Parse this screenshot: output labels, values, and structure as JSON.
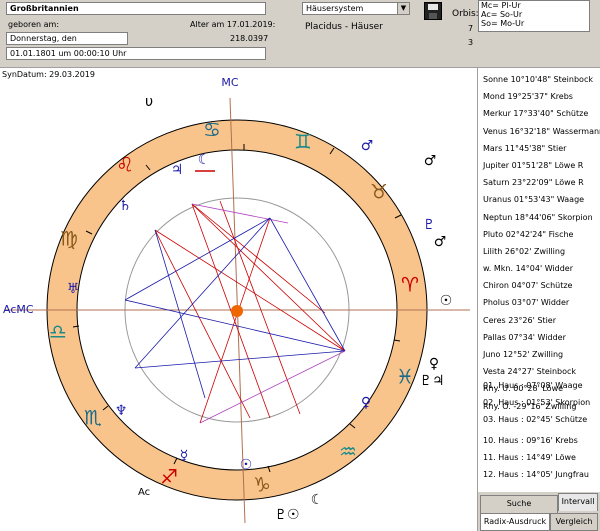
{
  "header": {
    "location": "Großbritannien",
    "born_label": "geboren am:",
    "age_label": "Alter am 17.01.2019:",
    "age_value": "218.0397",
    "weekday": "Donnerstag, den",
    "datetime": "01.01.1801  um  00:00:10 Uhr",
    "house_system_select": "Häusersystem",
    "orbis_label": "Orbis:",
    "house_system_name": "Placidus - Häuser",
    "num_1": "7",
    "num_2": "3",
    "orb_lines": [
      "Mc= Pl-Ur",
      "Ac= So-Ur",
      "So= Mo-Ur"
    ]
  },
  "chart": {
    "syn_date": "SynDatum: 29.03.2019",
    "labels": {
      "mc": "MC",
      "ac_left": "AcMC",
      "ac_bottom": "Ac"
    },
    "colors": {
      "zodiac_ring": "#f8c48c",
      "ring_stroke": "#000000",
      "fire": "#cc0000",
      "water": "#1a6a8a",
      "air": "#1a8a8a",
      "earth": "#8a5a1a",
      "aspect_red": "#cc0000",
      "aspect_blue": "#1a1aaa",
      "aspect_purple": "#b040c0",
      "sun_center": "#ee6600"
    },
    "signs": [
      {
        "name": "aries-sign",
        "glyph": "♈",
        "element": "fire"
      },
      {
        "name": "taurus-sign",
        "glyph": "♉",
        "element": "earth"
      },
      {
        "name": "gemini-sign",
        "glyph": "♊",
        "element": "air"
      },
      {
        "name": "cancer-sign",
        "glyph": "♋",
        "element": "water"
      },
      {
        "name": "leo-sign",
        "glyph": "♌",
        "element": "fire"
      },
      {
        "name": "virgo-sign",
        "glyph": "♍",
        "element": "earth"
      },
      {
        "name": "libra-sign",
        "glyph": "♎",
        "element": "air"
      },
      {
        "name": "scorpio-sign",
        "glyph": "♏",
        "element": "water"
      },
      {
        "name": "sagittarius-sign",
        "glyph": "♐",
        "element": "fire"
      },
      {
        "name": "capricorn-sign",
        "glyph": "♑",
        "element": "earth"
      },
      {
        "name": "aquarius-sign",
        "glyph": "♒",
        "element": "air"
      },
      {
        "name": "pisces-sign",
        "glyph": "♓",
        "element": "water"
      }
    ]
  },
  "planets": [
    "Sonne    10°10'48\" Steinbock",
    "Mond     19°25'37\" Krebs",
    "Merkur   17°33'40\" Schütze",
    "Venus    16°32'18\" Wassermann",
    "Mars     11°45'38\" Stier",
    "Jupiter  01°51'28\" Löwe R",
    "Saturn   23°22'09\" Löwe R",
    "Uranus   01°53'43\" Waage",
    "Neptun   18°44'06\" Skorpion",
    "Pluto    02°42'24\" Fische",
    "Lilith  26°02' Zwilling",
    "w. Mkn.  14°04' Widder",
    "Chiron   04°07' Schütze",
    "Pholus   03°07' Widder",
    "Ceres    23°26' Stier",
    "Pallas  07°34' Widder",
    "Juno     12°52' Zwilling",
    "Vesta    24°27' Steinbock",
    "Rhy. U.   00°28' Löwe",
    "Rhy. O.   -29°16' Zwilling"
  ],
  "houses_a": [
    "01. Haus :  07°08' Waage",
    "02. Haus :  01°53' Skorpion",
    "03. Haus :  02°45' Schütze"
  ],
  "houses_b": [
    "10. Haus :  09°16' Krebs",
    "11. Haus :  14°49' Löwe",
    "12. Haus :  14°05' Jungfrau"
  ],
  "tabs": {
    "suche": "Suche",
    "intervall": "Intervall",
    "radix": "Radix-Ausdruck",
    "vergleich": "Vergleich"
  }
}
